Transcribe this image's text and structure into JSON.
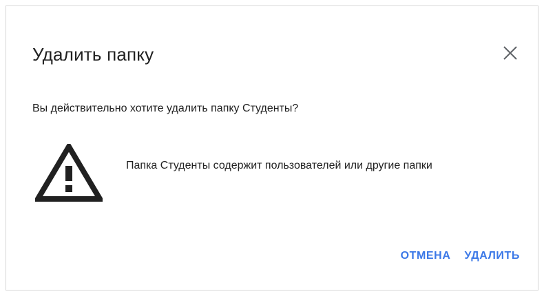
{
  "dialog": {
    "title": "Удалить папку",
    "close_icon": "close-icon",
    "message": "Вы действительно хотите удалить папку Студенты?",
    "warning": {
      "icon": "warning-triangle-icon",
      "text": "Папка Студенты содержит пользователей или другие папки"
    },
    "buttons": {
      "cancel_label": "ОТМЕНА",
      "delete_label": "УДАЛИТЬ"
    }
  },
  "colors": {
    "text": "#212121",
    "accent": "#3b78e7",
    "border": "#d6d6d6",
    "icon": "#212121"
  }
}
